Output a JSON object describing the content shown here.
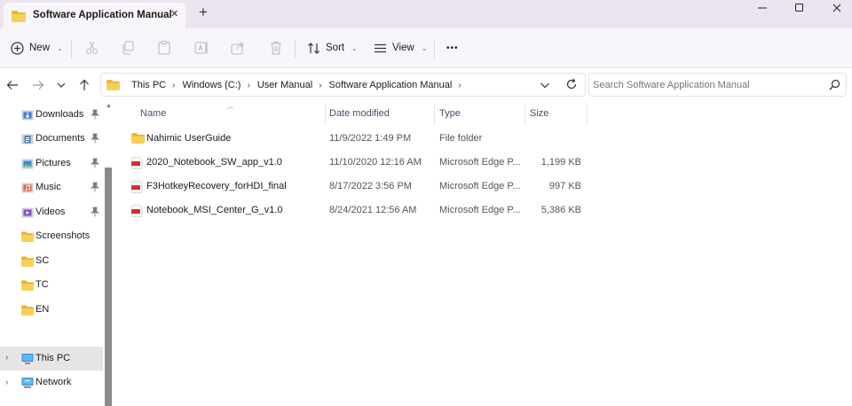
{
  "window": {
    "tab_title": "Software Application Manual",
    "tab_close": "✕",
    "new_tab": "+",
    "minimize": "—",
    "maximize": "☐",
    "close": "✕"
  },
  "toolbar": {
    "new_label": "New",
    "sort_label": "Sort",
    "view_label": "View",
    "more_label": "•••"
  },
  "address": {
    "crumbs": [
      "This PC",
      "Windows (C:)",
      "User Manual",
      "Software Application Manual"
    ],
    "search_placeholder": "Search Software Application Manual"
  },
  "sidebar": {
    "items": [
      {
        "label": "Downloads",
        "icon": "downloads-icon",
        "pinned": true
      },
      {
        "label": "Documents",
        "icon": "documents-icon",
        "pinned": true
      },
      {
        "label": "Pictures",
        "icon": "pictures-icon",
        "pinned": true
      },
      {
        "label": "Music",
        "icon": "music-icon",
        "pinned": true
      },
      {
        "label": "Videos",
        "icon": "videos-icon",
        "pinned": true
      },
      {
        "label": "Screenshots",
        "icon": "folder-icon",
        "pinned": false
      },
      {
        "label": "SC",
        "icon": "folder-icon",
        "pinned": false
      },
      {
        "label": "TC",
        "icon": "folder-icon",
        "pinned": false
      },
      {
        "label": "EN",
        "icon": "folder-icon",
        "pinned": false
      }
    ],
    "this_pc": "This PC",
    "network": "Network"
  },
  "columns": {
    "name": "Name",
    "date": "Date modified",
    "type": "Type",
    "size": "Size"
  },
  "files": [
    {
      "name": "Nahimic UserGuide",
      "date": "11/9/2022 1:49 PM",
      "type": "File folder",
      "size": "",
      "icon": "folder-icon"
    },
    {
      "name": "2020_Notebook_SW_app_v1.0",
      "date": "11/10/2020 12:16 AM",
      "type": "Microsoft Edge P...",
      "size": "1,199 KB",
      "icon": "pdf-file-icon"
    },
    {
      "name": "F3HotkeyRecovery_forHDI_final",
      "date": "8/17/2022 3:56 PM",
      "type": "Microsoft Edge P...",
      "size": "997 KB",
      "icon": "pdf-file-icon"
    },
    {
      "name": "Notebook_MSI_Center_G_v1.0",
      "date": "8/24/2021 12:56 AM",
      "type": "Microsoft Edge P...",
      "size": "5,386 KB",
      "icon": "pdf-file-icon"
    }
  ],
  "colors": {
    "tab_bar": "#ece4f1",
    "command_bar": "#f9f6fb",
    "folder": "#f4c542",
    "pdf": "#d32f2f",
    "accent": "#0067c0"
  }
}
